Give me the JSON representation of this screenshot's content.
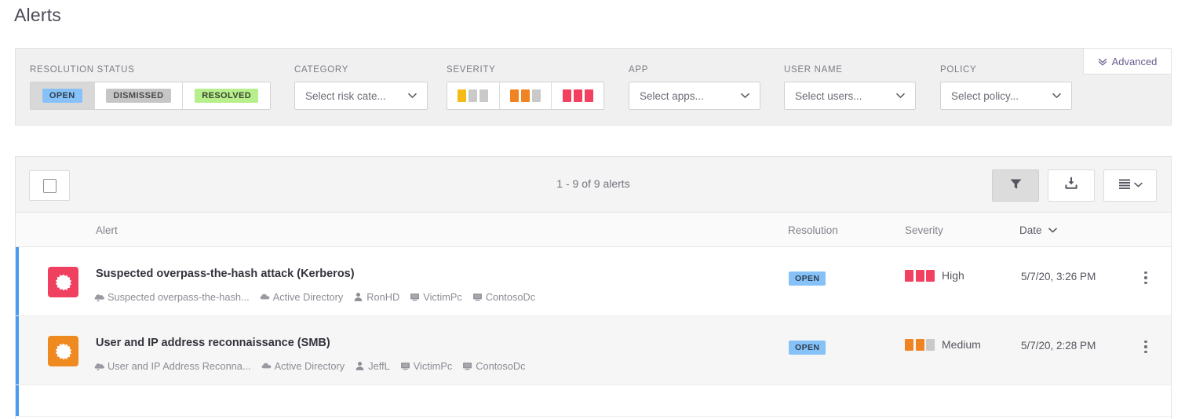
{
  "page": {
    "title": "Alerts"
  },
  "filters": {
    "advanced": {
      "label": "Advanced",
      "icon": "double-chevron-down-icon"
    },
    "resolution_status": {
      "label": "RESOLUTION STATUS",
      "options": [
        {
          "label": "OPEN",
          "selected": true
        },
        {
          "label": "DISMISSED",
          "selected": false
        },
        {
          "label": "RESOLVED",
          "selected": false
        }
      ]
    },
    "category": {
      "label": "CATEGORY",
      "placeholder": "Select risk cate...",
      "value": "Select risk cate..."
    },
    "severity": {
      "label": "SEVERITY",
      "levels": [
        {
          "name": "Low",
          "filled": 1,
          "color": "#f5bc18"
        },
        {
          "name": "Medium",
          "filled": 2,
          "color": "#f08422"
        },
        {
          "name": "High",
          "filled": 3,
          "color": "#f24060"
        }
      ],
      "empty_color": "#c9c9c9"
    },
    "app": {
      "label": "APP",
      "placeholder": "Select apps...",
      "value": "Select apps..."
    },
    "user_name": {
      "label": "USER NAME",
      "placeholder": "Select users...",
      "value": "Select users..."
    },
    "policy": {
      "label": "POLICY",
      "placeholder": "Select policy...",
      "value": "Select policy..."
    }
  },
  "toolbar": {
    "select_all": "select-all-checkbox",
    "count_text": "1 - 9 of 9 alerts",
    "buttons": [
      {
        "name": "filter-button",
        "icon": "funnel-icon",
        "active": true
      },
      {
        "name": "export-button",
        "icon": "download-tray-icon",
        "active": false
      },
      {
        "name": "view-options-button",
        "icon": "list-lines-icon",
        "active": false
      }
    ]
  },
  "table": {
    "columns": [
      {
        "key": "alert",
        "label": "Alert",
        "sorted": false
      },
      {
        "key": "resolution",
        "label": "Resolution",
        "sorted": false
      },
      {
        "key": "severity",
        "label": "Severity",
        "sorted": false
      },
      {
        "key": "date",
        "label": "Date",
        "sorted": true
      }
    ],
    "rows": [
      {
        "icon_color": "#ef4060",
        "title": "Suspected overpass-the-hash attack (Kerberos)",
        "meta": [
          {
            "icon": "policy-icon",
            "text": "Suspected overpass-the-hash..."
          },
          {
            "icon": "cloud-icon",
            "text": "Active Directory"
          },
          {
            "icon": "user-icon",
            "text": "RonHD"
          },
          {
            "icon": "computer-icon",
            "text": "VictimPc"
          },
          {
            "icon": "computer-icon",
            "text": "ContosoDc"
          }
        ],
        "resolution": "OPEN",
        "severity_label": "High",
        "severity_filled": 3,
        "severity_color": "#f24060",
        "date": "5/7/20, 3:26 PM"
      },
      {
        "icon_color": "#ef8a21",
        "title": "User and IP address reconnaissance (SMB)",
        "meta": [
          {
            "icon": "policy-icon",
            "text": "User and IP Address Reconna..."
          },
          {
            "icon": "cloud-icon",
            "text": "Active Directory"
          },
          {
            "icon": "user-icon",
            "text": "JeffL"
          },
          {
            "icon": "computer-icon",
            "text": "VictimPc"
          },
          {
            "icon": "computer-icon",
            "text": "ContosoDc"
          }
        ],
        "resolution": "OPEN",
        "severity_label": "Medium",
        "severity_filled": 2,
        "severity_color": "#f08422",
        "date": "5/7/20, 2:28 PM"
      }
    ]
  },
  "colors": {
    "row_accent": "#4b9cf0",
    "badge_open": "#86c2f7",
    "badge_dismissed": "#c6c6c6",
    "badge_resolved": "#b7ef8d",
    "link": "#6b5b8e"
  }
}
